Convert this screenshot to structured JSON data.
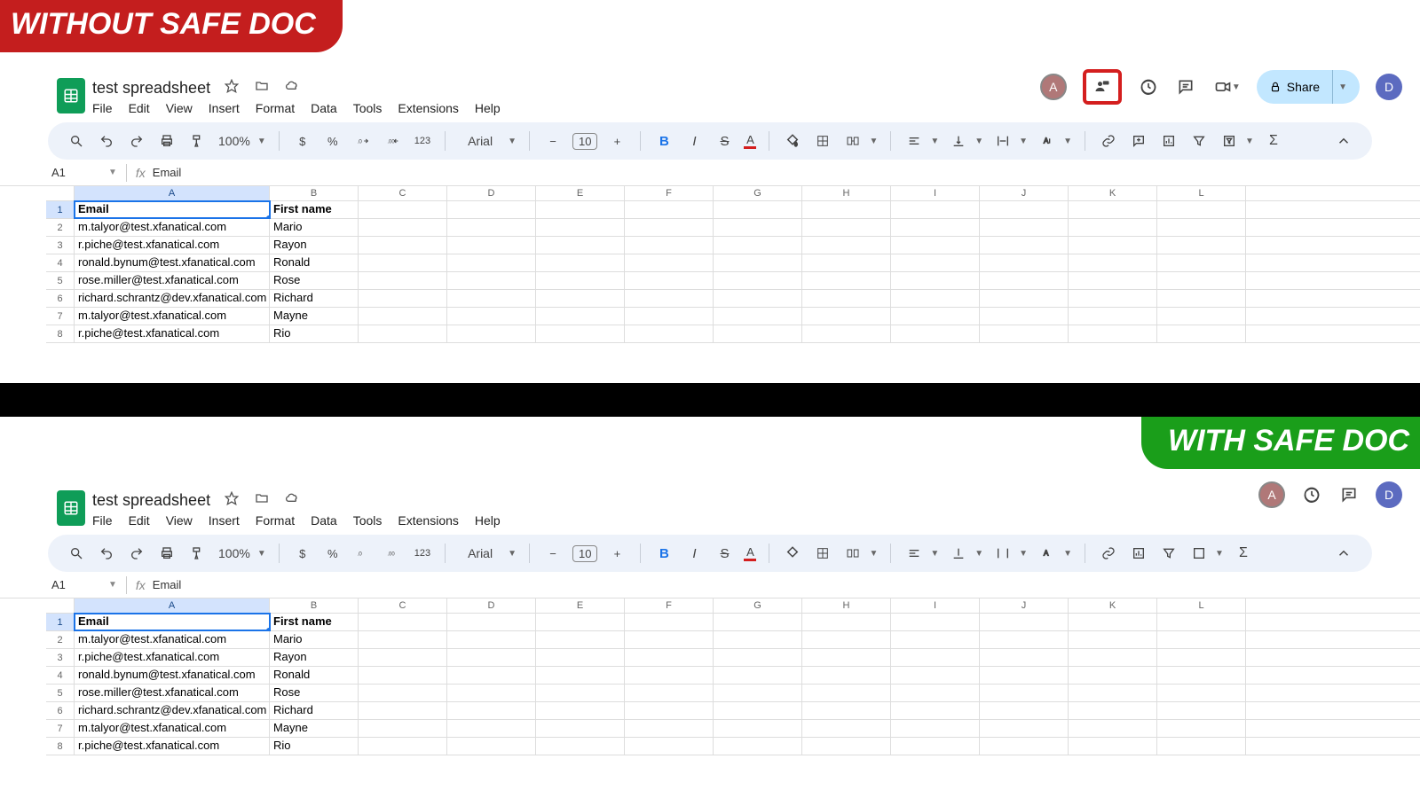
{
  "banner_without": "WITHOUT SAFE DOC",
  "banner_with": "WITH SAFE DOC",
  "doc": {
    "title": "test spreadsheet",
    "menus": [
      "File",
      "Edit",
      "View",
      "Insert",
      "Format",
      "Data",
      "Tools",
      "Extensions",
      "Help"
    ]
  },
  "toolbar": {
    "zoom": "100%",
    "currency": "$",
    "percent": "%",
    "num123": "123",
    "font": "Arial",
    "fontsize": "10",
    "bold": "B",
    "italic": "I",
    "strike": "S",
    "textcolor": "A",
    "sigma": "Σ"
  },
  "namebox": {
    "ref": "A1",
    "fx_label": "fx",
    "value": "Email"
  },
  "columns": [
    "A",
    "B",
    "C",
    "D",
    "E",
    "F",
    "G",
    "H",
    "I",
    "J",
    "K",
    "L"
  ],
  "headers": {
    "A": "Email",
    "B": "First name"
  },
  "rows": [
    {
      "A": "m.talyor@test.xfanatical.com",
      "B": "Mario"
    },
    {
      "A": "r.piche@test.xfanatical.com",
      "B": "Rayon"
    },
    {
      "A": "ronald.bynum@test.xfanatical.com",
      "B": "Ronald"
    },
    {
      "A": "rose.miller@test.xfanatical.com",
      "B": "Rose"
    },
    {
      "A": "richard.schrantz@dev.xfanatical.com",
      "B": "Richard"
    },
    {
      "A": "m.talyor@test.xfanatical.com",
      "B": "Mayne"
    },
    {
      "A": "r.piche@test.xfanatical.com",
      "B": "Rio"
    }
  ],
  "share": {
    "label": "Share"
  },
  "avatars": {
    "a": "A",
    "d": "D"
  }
}
